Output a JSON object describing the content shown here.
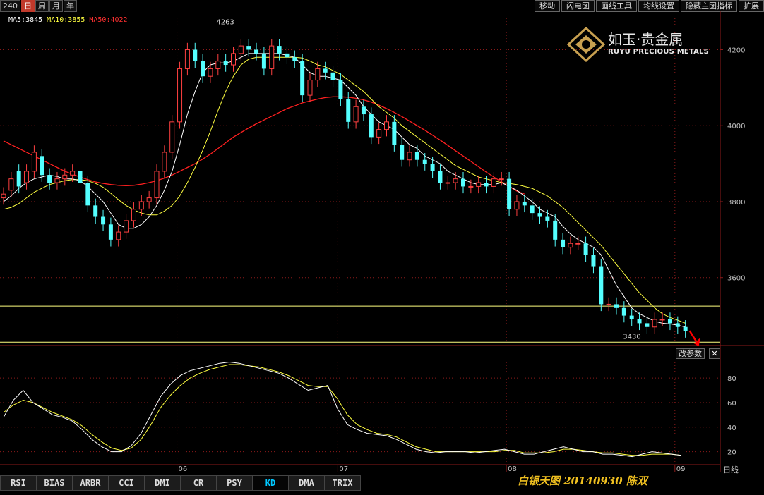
{
  "toolbar": {
    "period_partial": "240",
    "periods": [
      "日",
      "周",
      "月",
      "年"
    ],
    "active_period": "日",
    "tools": [
      "移动",
      "闪电图",
      "画线工具",
      "均线设置",
      "隐藏主图指标",
      "扩展"
    ]
  },
  "legend": {
    "ma5": "MA5:3845",
    "ma10": "MA10:3855",
    "ma50": "MA50:4022"
  },
  "logo": {
    "cn": "如玉·贵金属",
    "en": "RUYU PRECIOUS METALS"
  },
  "buttons": {
    "params": "改参数",
    "close": "✕"
  },
  "indicator_tabs": [
    "RSI",
    "BIAS",
    "ARBR",
    "CCI",
    "DMI",
    "CR",
    "PSY",
    "KD",
    "DMA",
    "TRIX"
  ],
  "active_indicator": "KD",
  "caption": "白银天图 20140930 陈双",
  "scale_label": "日线",
  "colors": {
    "up": "#ff4040",
    "down": "#54ffff",
    "ma5": "#ffffff",
    "ma10": "#ffff40",
    "ma50": "#ff2020",
    "support": "#ffff80",
    "arrow": "#ff0000",
    "grid": "#8b1a1a"
  },
  "chart_data": [
    {
      "type": "candlestick",
      "y_ticks": [
        3600,
        3800,
        4000,
        4200
      ],
      "ylim": [
        3425,
        4290
      ],
      "month_labels": [
        {
          "label": "06",
          "index": 23
        },
        {
          "label": "07",
          "index": 44
        },
        {
          "label": "08",
          "index": 66
        },
        {
          "label": "09",
          "index": 88
        }
      ],
      "annotations": {
        "high_label": "4263",
        "high_value": 4263,
        "low_label": "3430",
        "low_value": 3430,
        "support_value": 3525,
        "bottom_line_value": 3430
      },
      "close": [
        3820,
        3860,
        3840,
        3880,
        3930,
        3870,
        3850,
        3860,
        3870,
        3880,
        3850,
        3790,
        3760,
        3740,
        3700,
        3720,
        3750,
        3780,
        3800,
        3810,
        3880,
        3930,
        4010,
        4150,
        4200,
        4170,
        4130,
        4150,
        4170,
        4160,
        4190,
        4210,
        4200,
        4190,
        4150,
        4210,
        4190,
        4180,
        4170,
        4080,
        4120,
        4150,
        4140,
        4120,
        4070,
        4010,
        4050,
        4030,
        3970,
        3990,
        4010,
        3950,
        3910,
        3930,
        3910,
        3900,
        3880,
        3850,
        3850,
        3860,
        3840,
        3840,
        3850,
        3840,
        3860,
        3860,
        3780,
        3800,
        3790,
        3770,
        3760,
        3750,
        3700,
        3680,
        3690,
        3690,
        3660,
        3630,
        3530,
        3530,
        3520,
        3500,
        3490,
        3480,
        3470,
        3490,
        3490,
        3480,
        3470,
        3460
      ],
      "open": [
        3810,
        3830,
        3880,
        3850,
        3880,
        3920,
        3870,
        3850,
        3860,
        3870,
        3880,
        3850,
        3790,
        3760,
        3740,
        3700,
        3720,
        3750,
        3780,
        3800,
        3810,
        3880,
        3930,
        4010,
        4150,
        4200,
        4170,
        4130,
        4150,
        4170,
        4160,
        4190,
        4210,
        4200,
        4190,
        4150,
        4210,
        4190,
        4180,
        4170,
        4080,
        4120,
        4150,
        4140,
        4120,
        4070,
        4010,
        4050,
        4030,
        3970,
        3990,
        4010,
        3950,
        3910,
        3930,
        3910,
        3900,
        3880,
        3850,
        3850,
        3860,
        3840,
        3840,
        3850,
        3840,
        3860,
        3860,
        3780,
        3800,
        3790,
        3770,
        3760,
        3750,
        3700,
        3680,
        3690,
        3690,
        3660,
        3630,
        3530,
        3530,
        3520,
        3500,
        3490,
        3480,
        3470,
        3490,
        3490,
        3480,
        3470
      ],
      "ma5": [
        3800,
        3815,
        3835,
        3850,
        3860,
        3865,
        3870,
        3866,
        3860,
        3860,
        3855,
        3840,
        3820,
        3800,
        3770,
        3740,
        3730,
        3730,
        3740,
        3760,
        3790,
        3830,
        3880,
        3950,
        4030,
        4090,
        4140,
        4160,
        4165,
        4165,
        4170,
        4180,
        4190,
        4190,
        4190,
        4190,
        4190,
        4185,
        4180,
        4160,
        4140,
        4130,
        4130,
        4125,
        4120,
        4100,
        4080,
        4050,
        4030,
        4010,
        4000,
        3990,
        3970,
        3950,
        3940,
        3920,
        3910,
        3900,
        3880,
        3870,
        3860,
        3850,
        3845,
        3845,
        3845,
        3850,
        3840,
        3830,
        3815,
        3800,
        3780,
        3770,
        3760,
        3735,
        3715,
        3700,
        3690,
        3680,
        3660,
        3620,
        3580,
        3550,
        3520,
        3505,
        3495,
        3485,
        3480,
        3478,
        3475,
        3470
      ],
      "ma10": [
        3780,
        3785,
        3795,
        3810,
        3825,
        3835,
        3845,
        3850,
        3855,
        3858,
        3858,
        3855,
        3848,
        3838,
        3822,
        3805,
        3790,
        3778,
        3770,
        3765,
        3765,
        3775,
        3790,
        3815,
        3850,
        3890,
        3935,
        3985,
        4040,
        4090,
        4130,
        4160,
        4175,
        4180,
        4180,
        4180,
        4180,
        4180,
        4180,
        4178,
        4170,
        4160,
        4155,
        4145,
        4135,
        4120,
        4105,
        4090,
        4070,
        4050,
        4035,
        4020,
        4000,
        3985,
        3970,
        3955,
        3940,
        3925,
        3910,
        3895,
        3885,
        3875,
        3865,
        3860,
        3855,
        3850,
        3848,
        3845,
        3840,
        3835,
        3825,
        3815,
        3800,
        3785,
        3765,
        3745,
        3725,
        3705,
        3685,
        3660,
        3635,
        3610,
        3585,
        3560,
        3540,
        3520,
        3505,
        3495,
        3488,
        3480
      ],
      "ma50": [
        3960,
        3950,
        3940,
        3930,
        3920,
        3910,
        3900,
        3890,
        3880,
        3872,
        3865,
        3858,
        3852,
        3848,
        3845,
        3843,
        3842,
        3843,
        3846,
        3850,
        3855,
        3862,
        3870,
        3880,
        3890,
        3900,
        3912,
        3925,
        3940,
        3955,
        3970,
        3982,
        3994,
        4005,
        4015,
        4025,
        4035,
        4045,
        4052,
        4060,
        4065,
        4070,
        4074,
        4076,
        4076,
        4075,
        4072,
        4068,
        4062,
        4054,
        4045,
        4035,
        4024,
        4012,
        4000,
        3988,
        3975,
        3962,
        3948,
        3934,
        3920,
        3906,
        3892,
        3878,
        3865,
        3852,
        3840,
        3828,
        3820
      ]
    },
    {
      "type": "line",
      "name": "KD",
      "y_ticks": [
        20,
        40,
        60,
        80
      ],
      "ylim": [
        10,
        95
      ],
      "k": [
        48,
        62,
        70,
        60,
        55,
        50,
        48,
        45,
        38,
        30,
        24,
        20,
        20,
        25,
        35,
        50,
        65,
        75,
        82,
        86,
        88,
        90,
        92,
        93,
        92,
        90,
        88,
        86,
        84,
        80,
        75,
        70,
        72,
        74,
        55,
        42,
        38,
        35,
        34,
        33,
        30,
        26,
        22,
        20,
        19,
        20,
        20,
        20,
        19,
        20,
        21,
        22,
        20,
        18,
        18,
        20,
        22,
        24,
        22,
        20,
        20,
        18,
        18,
        17,
        16,
        18,
        20,
        19,
        18,
        17
      ],
      "d": [
        52,
        58,
        62,
        60,
        56,
        52,
        49,
        46,
        41,
        34,
        28,
        23,
        21,
        23,
        30,
        42,
        56,
        66,
        74,
        80,
        84,
        87,
        89,
        91,
        91,
        90,
        89,
        87,
        85,
        82,
        78,
        74,
        73,
        73,
        63,
        50,
        42,
        38,
        35,
        34,
        32,
        28,
        24,
        22,
        20,
        20,
        20,
        20,
        20,
        20,
        20,
        21,
        21,
        19,
        19,
        19,
        20,
        22,
        22,
        21,
        20,
        19,
        19,
        18,
        17,
        17,
        18,
        18,
        18,
        17
      ]
    }
  ]
}
